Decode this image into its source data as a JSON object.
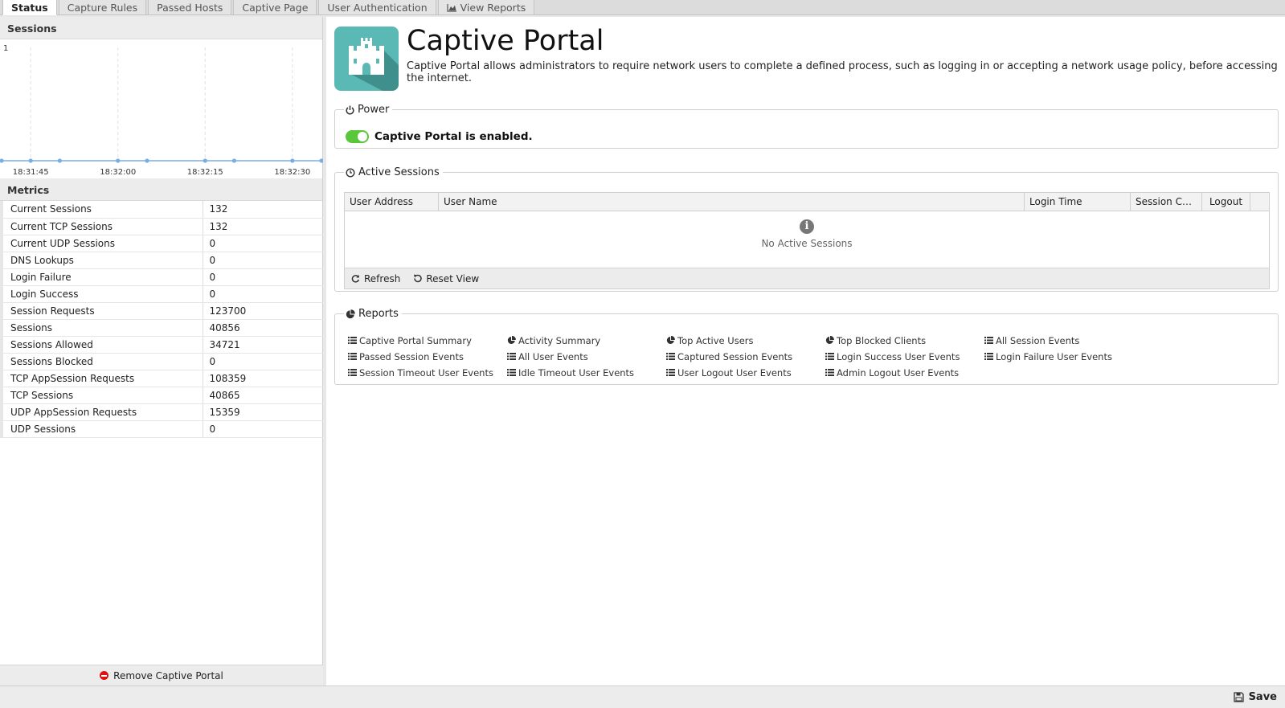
{
  "tabs": [
    {
      "label": "Status"
    },
    {
      "label": "Capture Rules"
    },
    {
      "label": "Passed Hosts"
    },
    {
      "label": "Captive Page"
    },
    {
      "label": "User Authentication"
    },
    {
      "label": "View Reports",
      "icon": "area-chart-icon"
    }
  ],
  "sessions_panel": {
    "title": "Sessions",
    "chart_data": {
      "type": "line",
      "x": [
        "18:31:40",
        "18:31:45",
        "18:31:50",
        "18:32:00",
        "18:32:05",
        "18:32:15",
        "18:32:20",
        "18:32:30",
        "18:32:35"
      ],
      "values": [
        0,
        0,
        0,
        0,
        0,
        0,
        0,
        0,
        0
      ],
      "tick_labels": [
        "18:31:45",
        "18:32:00",
        "18:32:15",
        "18:32:30"
      ],
      "y_tick_labels": [
        "1"
      ],
      "ylim": [
        0,
        1
      ],
      "line_color": "#7aaee0"
    }
  },
  "metrics": {
    "title": "Metrics",
    "rows": [
      {
        "name": "Current Sessions",
        "value": "132"
      },
      {
        "name": "Current TCP Sessions",
        "value": "132"
      },
      {
        "name": "Current UDP Sessions",
        "value": "0"
      },
      {
        "name": "DNS Lookups",
        "value": "0"
      },
      {
        "name": "Login Failure",
        "value": "0"
      },
      {
        "name": "Login Success",
        "value": "0"
      },
      {
        "name": "Session Requests",
        "value": "123700"
      },
      {
        "name": "Sessions",
        "value": "40856"
      },
      {
        "name": "Sessions Allowed",
        "value": "34721"
      },
      {
        "name": "Sessions Blocked",
        "value": "0"
      },
      {
        "name": "TCP AppSession Requests",
        "value": "108359"
      },
      {
        "name": "TCP Sessions",
        "value": "40865"
      },
      {
        "name": "UDP AppSession Requests",
        "value": "15359"
      },
      {
        "name": "UDP Sessions",
        "value": "0"
      }
    ]
  },
  "remove_label": "Remove Captive Portal",
  "app": {
    "title": "Captive Portal",
    "description": "Captive Portal allows administrators to require network users to complete a defined process, such as logging in or accepting a network usage policy, before accessing the internet.",
    "icon_color": "#5ab8b5"
  },
  "power": {
    "legend": "Power",
    "status_text": "Captive Portal is enabled."
  },
  "active_sessions": {
    "legend": "Active Sessions",
    "columns": [
      "User Address",
      "User Name",
      "Login Time",
      "Session Co...",
      "Logout"
    ],
    "empty_text": "No Active Sessions",
    "refresh_label": "Refresh",
    "reset_label": "Reset View"
  },
  "reports": {
    "legend": "Reports",
    "links": [
      {
        "label": "Captive Portal Summary",
        "icon": "list-icon"
      },
      {
        "label": "Activity Summary",
        "icon": "pie-icon"
      },
      {
        "label": "Top Active Users",
        "icon": "pie-icon"
      },
      {
        "label": "Top Blocked Clients",
        "icon": "pie-icon"
      },
      {
        "label": "All Session Events",
        "icon": "list-icon"
      },
      {
        "label": "Passed Session Events",
        "icon": "list-icon"
      },
      {
        "label": "All User Events",
        "icon": "list-icon"
      },
      {
        "label": "Captured Session Events",
        "icon": "list-icon"
      },
      {
        "label": "Login Success User Events",
        "icon": "list-icon"
      },
      {
        "label": "Login Failure User Events",
        "icon": "list-icon"
      },
      {
        "label": "Session Timeout User Events",
        "icon": "list-icon"
      },
      {
        "label": "Idle Timeout User Events",
        "icon": "list-icon"
      },
      {
        "label": "User Logout User Events",
        "icon": "list-icon"
      },
      {
        "label": "Admin Logout User Events",
        "icon": "list-icon"
      }
    ]
  },
  "save_label": "Save"
}
